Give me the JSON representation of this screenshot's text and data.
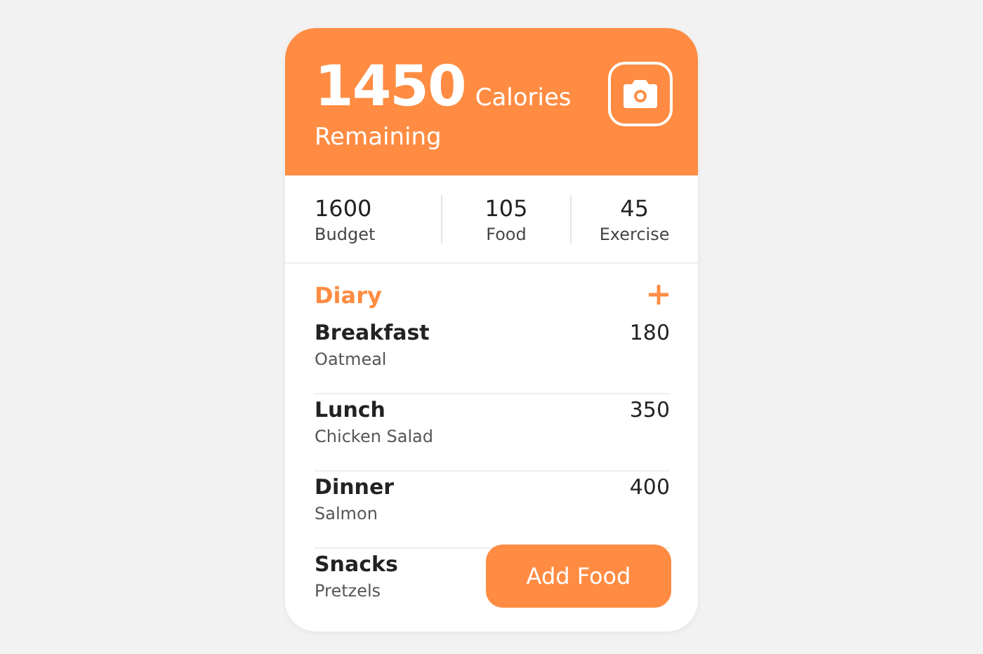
{
  "summary": {
    "value": "1450",
    "unit": "Calories",
    "label": "Remaining"
  },
  "stats": [
    {
      "value": "1600",
      "label": "Budget"
    },
    {
      "value": "105",
      "label": "Food"
    },
    {
      "value": "45",
      "label": "Exercise"
    }
  ],
  "diary": {
    "title": "Diary",
    "meals": [
      {
        "name": "Breakfast",
        "food": "Oatmeal",
        "calories": "180"
      },
      {
        "name": "Lunch",
        "food": "Chicken Salad",
        "calories": "350"
      },
      {
        "name": "Dinner",
        "food": "Salmon",
        "calories": "400"
      },
      {
        "name": "Snacks",
        "food": "Pretzels"
      }
    ]
  },
  "action_button": "Add Food"
}
